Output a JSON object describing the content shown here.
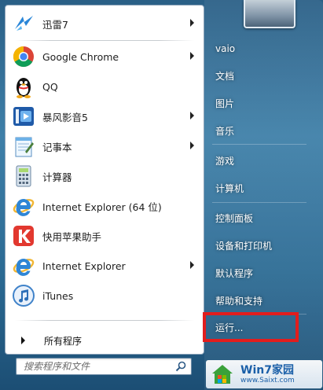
{
  "programs": [
    {
      "label": "迅雷7",
      "icon": "thunder-bird-icon",
      "has_submenu": true
    },
    {
      "label": "Google Chrome",
      "icon": "chrome-icon",
      "has_submenu": true
    },
    {
      "label": "QQ",
      "icon": "qq-penguin-icon",
      "has_submenu": false
    },
    {
      "label": "暴风影音5",
      "icon": "baofeng-icon",
      "has_submenu": true
    },
    {
      "label": "记事本",
      "icon": "notepad-icon",
      "has_submenu": true
    },
    {
      "label": "计算器",
      "icon": "calculator-icon",
      "has_submenu": false
    },
    {
      "label": "Internet Explorer (64 位)",
      "icon": "ie-icon",
      "has_submenu": false
    },
    {
      "label": "快用苹果助手",
      "icon": "kuaiyong-icon",
      "has_submenu": false
    },
    {
      "label": "Internet Explorer",
      "icon": "ie-icon",
      "has_submenu": true
    },
    {
      "label": "iTunes",
      "icon": "itunes-icon",
      "has_submenu": false
    }
  ],
  "all_programs_label": "所有程序",
  "search": {
    "placeholder": "搜索程序和文件"
  },
  "right_items": [
    {
      "label": "vaio"
    },
    {
      "label": "文档"
    },
    {
      "label": "图片"
    },
    {
      "label": "音乐"
    },
    {
      "label": "游戏"
    },
    {
      "label": "计算机"
    },
    {
      "label": "控制面板"
    },
    {
      "label": "设备和打印机"
    },
    {
      "label": "默认程序"
    },
    {
      "label": "帮助和支持"
    },
    {
      "label": "运行..."
    }
  ],
  "highlight_color": "#e11d1d",
  "watermark": {
    "title": "Win7家园",
    "url": "www.Saixt.com"
  }
}
